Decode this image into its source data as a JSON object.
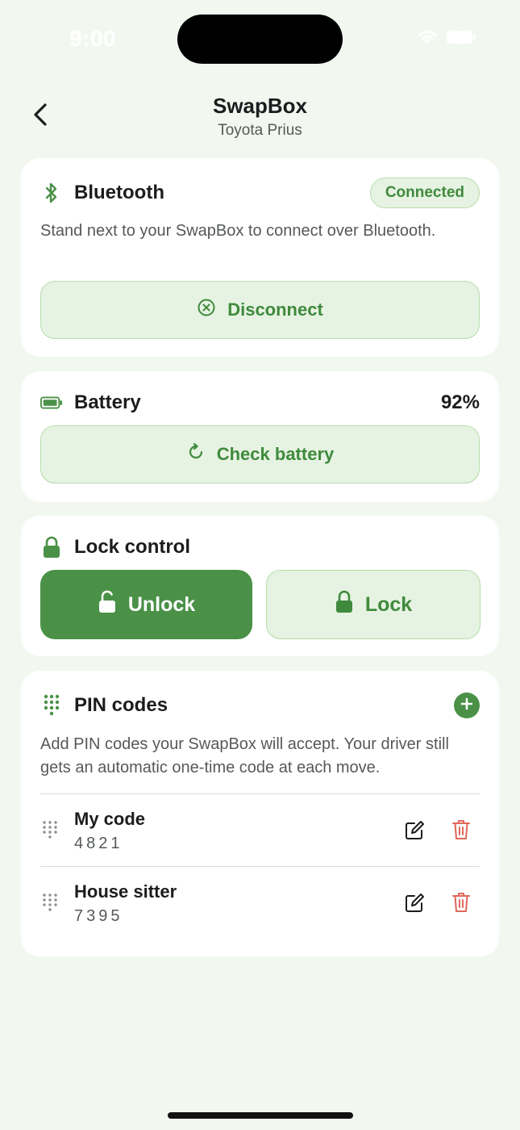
{
  "status_bar": {
    "time": "9:00"
  },
  "nav": {
    "title": "SwapBox",
    "subtitle": "Toyota Prius"
  },
  "bluetooth": {
    "title": "Bluetooth",
    "status": "Connected",
    "description": "Stand next to your SwapBox to connect over Bluetooth.",
    "button_label": "Disconnect",
    "icon": "bluetooth-icon"
  },
  "battery": {
    "title": "Battery",
    "value": "92%",
    "button_label": "Check battery",
    "icon": "battery-icon"
  },
  "lock_control": {
    "title": "Lock control",
    "unlock_label": "Unlock",
    "lock_label": "Lock"
  },
  "pin_codes": {
    "title": "PIN codes",
    "description": "Add PIN codes your SwapBox will accept. Your driver still gets an automatic one-time code at each move.",
    "items": [
      {
        "name": "My code",
        "code": "4821"
      },
      {
        "name": "House sitter",
        "code": "7395"
      }
    ]
  },
  "colors": {
    "background": "#f2f8f0",
    "accent": "#4a9147",
    "accent_soft": "#e6f3e2",
    "accent_border": "#b6dcaa",
    "accent_text": "#3f8a3d",
    "danger": "#e0685a"
  }
}
